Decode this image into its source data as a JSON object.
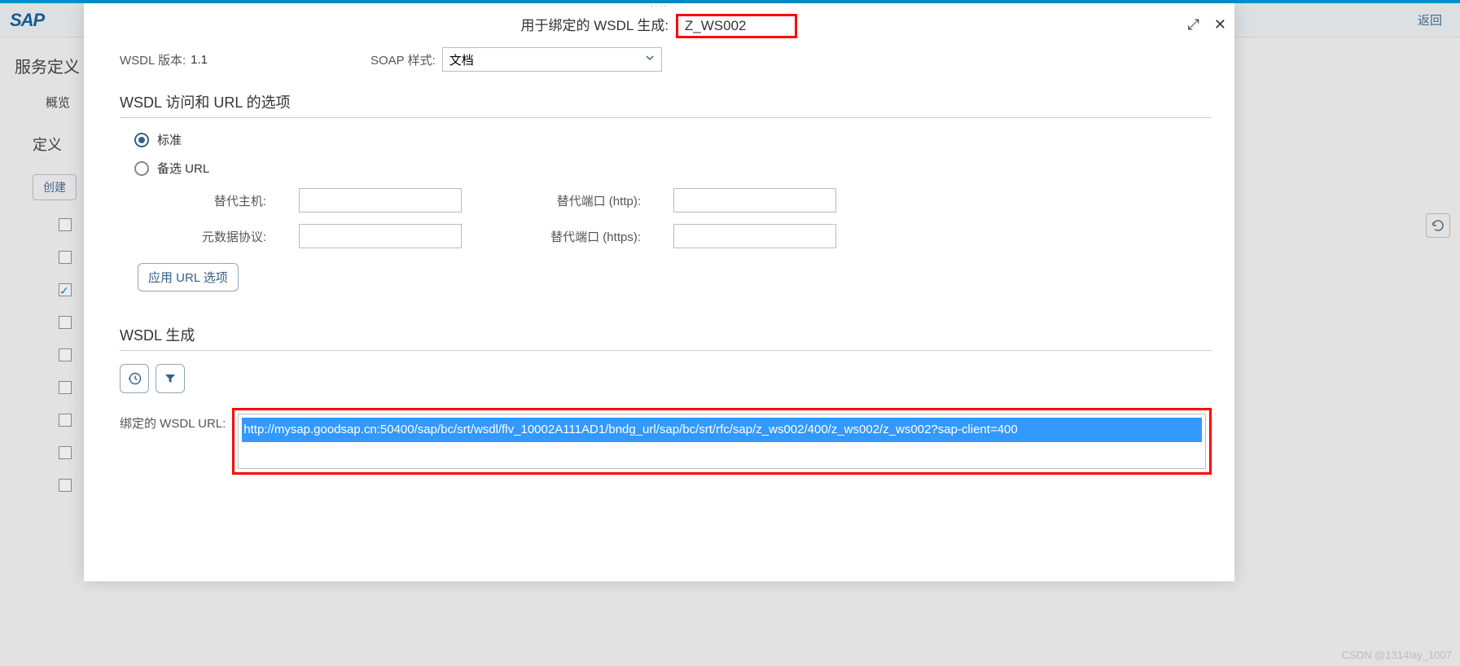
{
  "accent": "#009de0",
  "sap_logo_text": "SAP",
  "bg": {
    "back_button": "返回",
    "page_title": "服务定义 的",
    "tab_overview": "概览",
    "section_definition": "定义",
    "create_button": "创建",
    "refresh_icon": "refresh-icon"
  },
  "modal": {
    "title_prefix": "用于绑定的 WSDL 生成:",
    "service_id": "Z_WS002",
    "icons": {
      "expand": "⤢",
      "close": "✕"
    },
    "wsdl_version_label": "WSDL 版本:",
    "wsdl_version_value": "1.1",
    "soap_style_label": "SOAP 样式:",
    "soap_style_value": "文档",
    "section_access": "WSDL 访问和 URL 的选项",
    "radio_standard": "标准",
    "radio_alt": "备选 URL",
    "field_alt_host": "替代主机:",
    "field_metadata": "元数据协议:",
    "field_port_http": "替代端口 (http):",
    "field_port_https": "替代端口 (https):",
    "apply_button": "应用 URL 选项",
    "section_generate": "WSDL 生成",
    "url_label": "绑定的 WSDL URL:",
    "url_value": "http://mysap.goodsap.cn:50400/sap/bc/srt/wsdl/flv_10002A111AD1/bndg_url/sap/bc/srt/rfc/sap/z_ws002/400/z_ws002/z_ws002?sap-client=400"
  },
  "watermark": "CSDN @1314lay_1007"
}
